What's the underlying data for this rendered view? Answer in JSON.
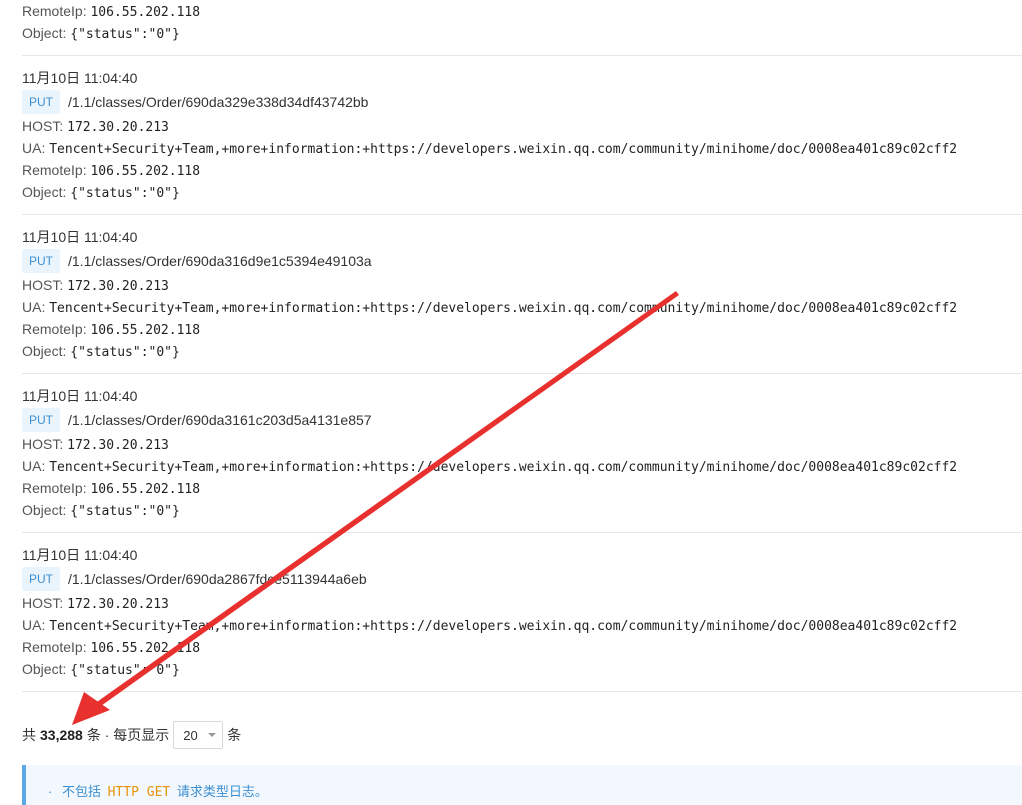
{
  "labels": {
    "host": "HOST:",
    "ua": "UA:",
    "remote_ip": "RemoteIp:",
    "object": "Object:"
  },
  "top_partial": {
    "remote_ip": "106.55.202.118",
    "object": "{\"status\":\"0\"}"
  },
  "entries": [
    {
      "time": "11月10日 11:04:40",
      "method": "PUT",
      "path": "/1.1/classes/Order/690da329e338d34df43742bb",
      "host": "172.30.20.213",
      "ua": "Tencent+Security+Team,+more+information:+https://developers.weixin.qq.com/community/minihome/doc/0008ea401c89c02cff2",
      "remote_ip": "106.55.202.118",
      "object": "{\"status\":\"0\"}"
    },
    {
      "time": "11月10日 11:04:40",
      "method": "PUT",
      "path": "/1.1/classes/Order/690da316d9e1c5394e49103a",
      "host": "172.30.20.213",
      "ua": "Tencent+Security+Team,+more+information:+https://developers.weixin.qq.com/community/minihome/doc/0008ea401c89c02cff2",
      "remote_ip": "106.55.202.118",
      "object": "{\"status\":\"0\"}"
    },
    {
      "time": "11月10日 11:04:40",
      "method": "PUT",
      "path": "/1.1/classes/Order/690da3161c203d5a4131e857",
      "host": "172.30.20.213",
      "ua": "Tencent+Security+Team,+more+information:+https://developers.weixin.qq.com/community/minihome/doc/0008ea401c89c02cff2",
      "remote_ip": "106.55.202.118",
      "object": "{\"status\":\"0\"}"
    },
    {
      "time": "11月10日 11:04:40",
      "method": "PUT",
      "path": "/1.1/classes/Order/690da2867fdce5113944a6eb",
      "host": "172.30.20.213",
      "ua": "Tencent+Security+Team,+more+information:+https://developers.weixin.qq.com/community/minihome/doc/0008ea401c89c02cff2",
      "remote_ip": "106.55.202.118",
      "object": "{\"status\":\"0\"}"
    }
  ],
  "pagination": {
    "prefix": "共",
    "total": "33,288",
    "unit_after_total": "条 · 每页显示",
    "page_size": "20",
    "suffix": "条"
  },
  "notice": {
    "bullet": "·",
    "before": "不包括",
    "code": "HTTP GET",
    "after": "请求类型日志。"
  },
  "colors": {
    "badge_bg": "#eaf4fc",
    "badge_text": "#3d8fd1",
    "arrow": "#e8312f",
    "notice_border": "#5aa8e6",
    "code": "#e8930c"
  }
}
